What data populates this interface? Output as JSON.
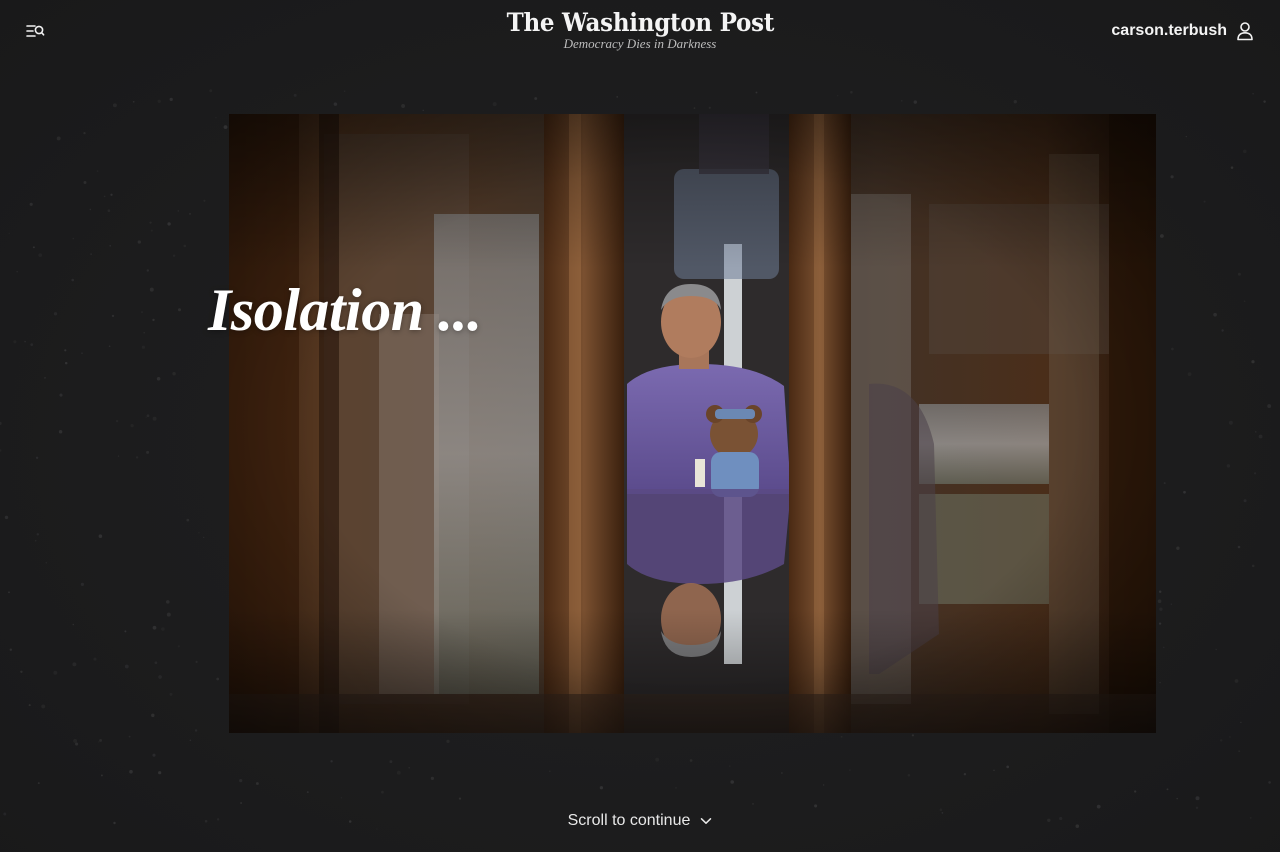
{
  "header": {
    "logo_text": "The Washington Post",
    "tagline": "Democracy Dies in Darkness",
    "username": "carson.terbush",
    "menu_icon": "menu-search-icon",
    "user_icon": "user-icon"
  },
  "hero": {
    "headline": "Isolation ..."
  },
  "footer": {
    "scroll_label": "Scroll to continue",
    "scroll_icon": "chevron-down-icon"
  },
  "colors": {
    "background": "#1e1e1f",
    "text": "#f4f4f4",
    "tagline": "#bdbdbd"
  }
}
